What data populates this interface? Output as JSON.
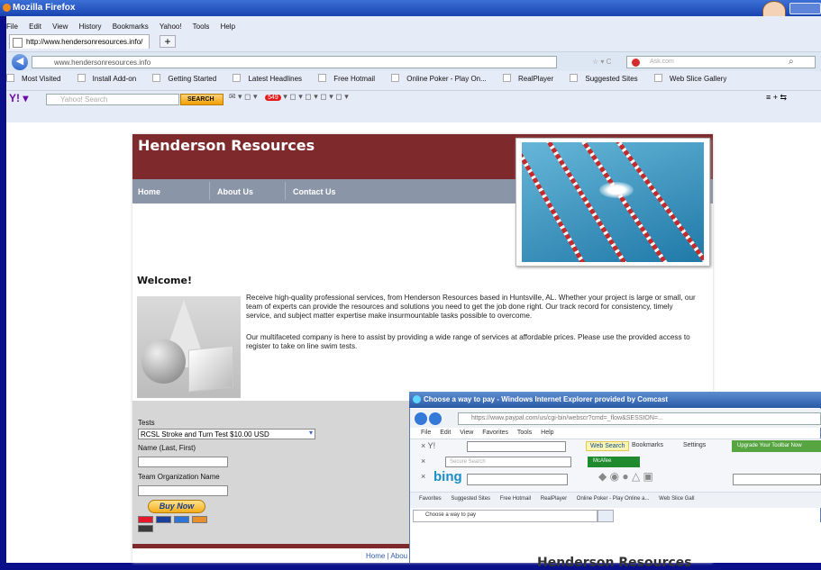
{
  "firefox": {
    "title": "Mozilla Firefox",
    "menu": [
      "File",
      "Edit",
      "View",
      "History",
      "Bookmarks",
      "Yahoo!",
      "Tools",
      "Help"
    ],
    "tab_title": "http://www.hendersonresources.info/",
    "new_tab": "+",
    "url": "www.hendersonresources.info",
    "search_placeholder": "Ask.com",
    "bookmarks": [
      "Most Visited",
      "Install Add-on",
      "Getting Started",
      "Latest Headlines",
      "Free Hotmail",
      "Online Poker - Play On...",
      "RealPlayer",
      "Suggested Sites",
      "Web Slice Gallery"
    ],
    "yahoo_search_placeholder": "Yahoo! Search",
    "yahoo_search_button": "SEARCH",
    "notification_count": "549"
  },
  "site": {
    "title": "Henderson Resources",
    "nav": [
      "Home",
      "About Us",
      "Contact Us"
    ],
    "welcome": "Welcome!",
    "para1": "Receive high-quality professional services, from Henderson Resources based in Huntsville, AL. Whether your project is large or small, our team of experts can provide the resources and solutions you need to get the job done right. Our track record for consistency, timely service, and subject matter expertise make insurmountable tasks possible to overcome.",
    "para2": "Our multifaceted company is here to assist by providing a wide range of services at affordable prices. Please use the provided access to register to take on line swim tests.",
    "form": {
      "tests_label": "Tests",
      "selected_test": "RCSL Stroke and Turn Test $10.00 USD",
      "name_label": "Name (Last, First)",
      "team_label": "Team Organization Name",
      "buy_button": "Buy Now"
    },
    "footer": "Home | Abou"
  },
  "ie": {
    "title": "Choose a way to pay - Windows Internet Explorer provided by Comcast",
    "url": "https://www.paypal.com/us/cgi-bin/webscr?cmd=_flow&SESSION=...",
    "menu": [
      "File",
      "Edit",
      "View",
      "Favorites",
      "Tools",
      "Help"
    ],
    "web_search": "Web Search",
    "bookmarks": "Bookmarks",
    "settings": "Settings",
    "upgrade": "Upgrade Your Toolbar Now",
    "secure_search": "Secure Search",
    "mcafee": "McAfee",
    "bing": "bing",
    "favorites": [
      "Favorites",
      "Suggested Sites",
      "Free Hotmail",
      "RealPlayer",
      "Online Poker - Play Online a...",
      "Web Slice Gall"
    ],
    "tab": "Choose a way to pay",
    "page_title": "Henderson Resources"
  }
}
